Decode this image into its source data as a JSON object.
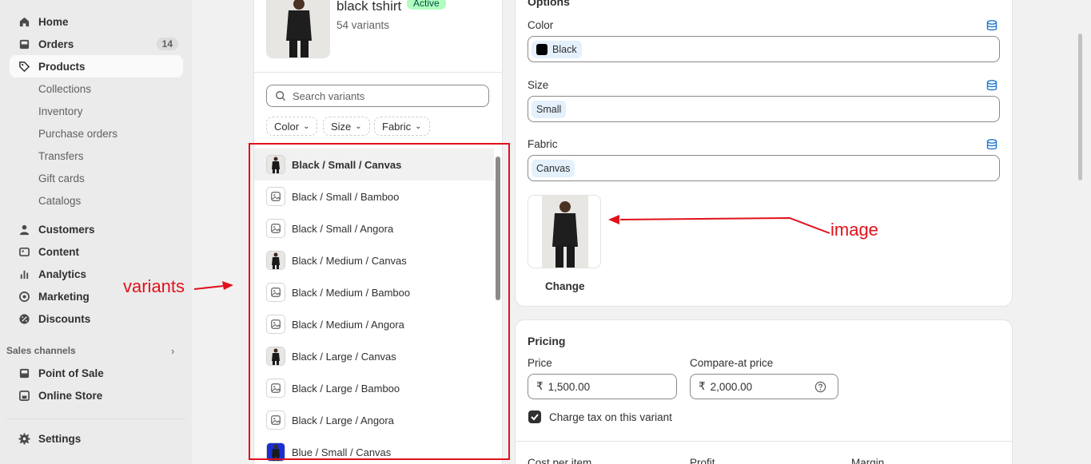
{
  "sidebar": {
    "items": [
      {
        "label": "Home",
        "icon": "home-icon"
      },
      {
        "label": "Orders",
        "icon": "inbox-icon",
        "badge": "14"
      },
      {
        "label": "Products",
        "icon": "tag-icon"
      },
      {
        "label": "Customers",
        "icon": "person-icon"
      },
      {
        "label": "Content",
        "icon": "image-icon"
      },
      {
        "label": "Analytics",
        "icon": "bar-chart-icon"
      },
      {
        "label": "Marketing",
        "icon": "target-icon"
      },
      {
        "label": "Discounts",
        "icon": "discount-icon"
      }
    ],
    "product_sub": [
      "Collections",
      "Inventory",
      "Purchase orders",
      "Transfers",
      "Gift cards",
      "Catalogs"
    ],
    "sales_channels_label": "Sales channels",
    "channels": [
      {
        "label": "Point of Sale",
        "icon": "pos-icon"
      },
      {
        "label": "Online Store",
        "icon": "store-icon"
      }
    ],
    "settings_label": "Settings"
  },
  "product": {
    "title": "black tshirt",
    "status": "Active",
    "variant_count": "54 variants"
  },
  "variant_list": {
    "search_placeholder": "Search variants",
    "filters": [
      "Color",
      "Size",
      "Fabric"
    ],
    "variants": [
      {
        "label": "Black / Small / Canvas",
        "has_image": true,
        "selected": true
      },
      {
        "label": "Black / Small / Bamboo",
        "has_image": false
      },
      {
        "label": "Black / Small / Angora",
        "has_image": false
      },
      {
        "label": "Black / Medium / Canvas",
        "has_image": true
      },
      {
        "label": "Black / Medium / Bamboo",
        "has_image": false
      },
      {
        "label": "Black / Medium / Angora",
        "has_image": false
      },
      {
        "label": "Black / Large / Canvas",
        "has_image": true
      },
      {
        "label": "Black / Large / Bamboo",
        "has_image": false
      },
      {
        "label": "Black / Large / Angora",
        "has_image": false
      },
      {
        "label": "Blue / Small / Canvas",
        "has_image": true,
        "blue": true
      }
    ]
  },
  "options": {
    "heading": "Options",
    "color_label": "Color",
    "color_value": "Black",
    "size_label": "Size",
    "size_value": "Small",
    "fabric_label": "Fabric",
    "fabric_value": "Canvas",
    "change_label": "Change"
  },
  "pricing": {
    "heading": "Pricing",
    "price_label": "Price",
    "price_value": "1,500.00",
    "compare_label": "Compare-at price",
    "compare_value": "2,000.00",
    "currency": "₹",
    "tax_label": "Charge tax on this variant",
    "cost_label": "Cost per item",
    "profit_label": "Profit",
    "margin_label": "Margin"
  },
  "annotations": {
    "variants": "variants",
    "image": "image"
  },
  "colors": {
    "annotation_red": "#e0111c",
    "status_green": "#affebf",
    "tag_blue": "#e4f0fb"
  }
}
